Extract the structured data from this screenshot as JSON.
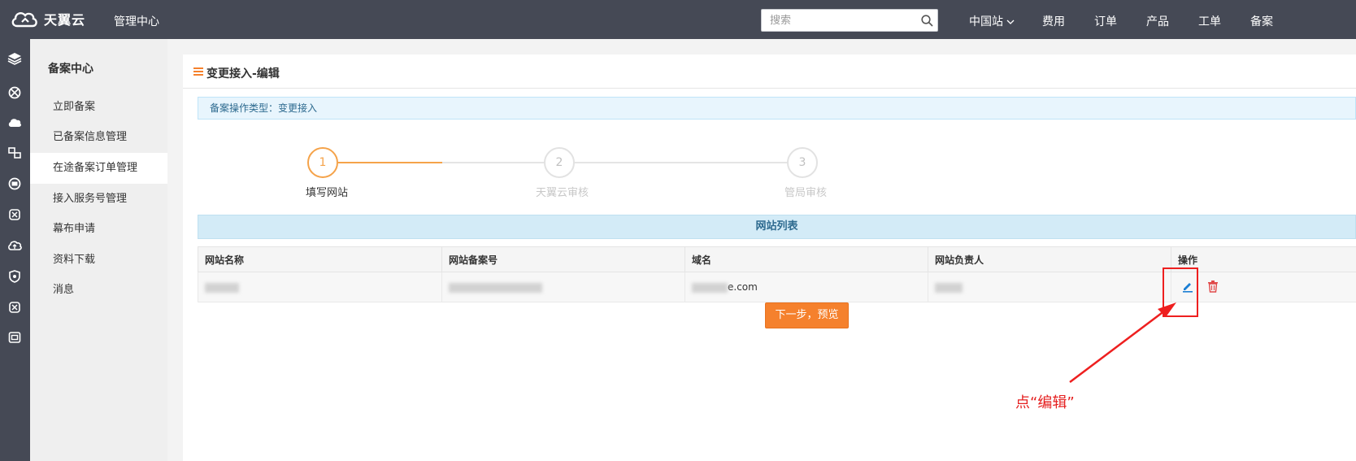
{
  "header": {
    "brand": "天翼云",
    "console_title": "管理中心",
    "search_placeholder": "搜索",
    "nav": [
      "中国站",
      "费用",
      "订单",
      "产品",
      "工单",
      "备案"
    ]
  },
  "sidebar": {
    "title": "备案中心",
    "items": [
      {
        "label": "立即备案"
      },
      {
        "label": "已备案信息管理"
      },
      {
        "label": "在途备案订单管理"
      },
      {
        "label": "接入服务号管理"
      },
      {
        "label": "幕布申请"
      },
      {
        "label": "资料下载"
      },
      {
        "label": "消息"
      }
    ],
    "active_index": 2
  },
  "page": {
    "title": "变更接入-编辑",
    "info": "备案操作类型：变更接入"
  },
  "steps": [
    {
      "number": "1",
      "label": "填写网站",
      "state": "active"
    },
    {
      "number": "2",
      "label": "天翼云审核",
      "state": "pending"
    },
    {
      "number": "3",
      "label": "管局审核",
      "state": "pending"
    }
  ],
  "website_list": {
    "title": "网站列表",
    "columns": [
      "网站名称",
      "网站备案号",
      "域名",
      "网站负责人",
      "操作"
    ],
    "rows": [
      {
        "domain_suffix": "e.com"
      }
    ]
  },
  "next_button": "下一步，预览",
  "annotation": "点“编辑”",
  "colors": {
    "topbar": "#454955",
    "accent_orange": "#f5812d",
    "step_active": "#f5a34a",
    "info_blue": "#2d6a8f",
    "edit_icon": "#1a7fd4",
    "delete_icon": "#e04a4a",
    "annotation_red": "#e52020"
  }
}
